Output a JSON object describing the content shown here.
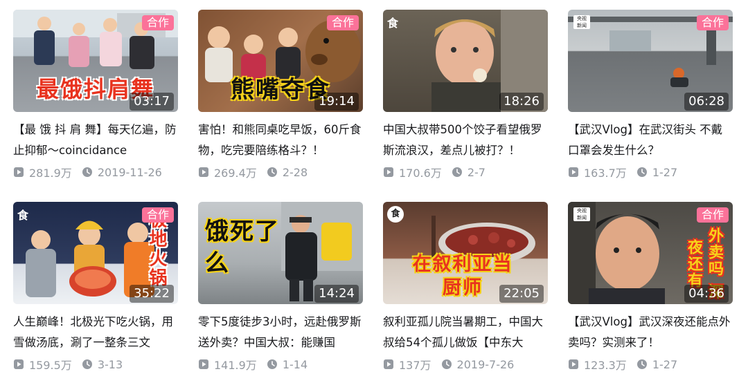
{
  "videos": [
    {
      "title": "【最 饿 抖 肩 舞】每天亿遍，防止抑郁～coincidance",
      "caption": "最饿抖肩舞",
      "coop": "合作",
      "duration": "03:17",
      "views": "281.9万",
      "date": "2019-11-26"
    },
    {
      "title": "害怕！和熊同桌吃早饭，60斤食物，吃完要陪练格斗？！",
      "caption": "熊嘴夺食",
      "coop": "合作",
      "duration": "19:14",
      "views": "269.4万",
      "date": "2-28"
    },
    {
      "title": "中国大叔带500个饺子看望俄罗斯流浪汉，差点儿被打？！",
      "caption": "",
      "coop": "",
      "duration": "18:26",
      "views": "170.6万",
      "date": "2-7"
    },
    {
      "title": "【武汉Vlog】在武汉街头 不戴口罩会发生什么？",
      "caption": "",
      "coop": "合作",
      "duration": "06:28",
      "views": "163.7万",
      "date": "1-27"
    },
    {
      "title": "人生巅峰！北极光下吃火锅，用雪做汤底，涮了一整条三文",
      "caption": "极地火锅",
      "coop": "合作",
      "duration": "35:22",
      "views": "159.5万",
      "date": "3-13"
    },
    {
      "title": "零下5度徒步3小时，远赴俄罗斯送外卖？中国大叔：能赚国",
      "caption": "饿死了么",
      "coop": "",
      "duration": "14:24",
      "views": "141.9万",
      "date": "1-14"
    },
    {
      "title": "叙利亚孤儿院当暑期工，中国大叔给54个孤儿做饭【中东大",
      "caption": "在叙利亚当厨师",
      "coop": "",
      "duration": "22:05",
      "views": "137万",
      "date": "2019-7-26"
    },
    {
      "title": "【武汉Vlog】武汉深夜还能点外卖吗？实测来了！",
      "caption": "外卖吗 深夜还有",
      "coop": "合作",
      "duration": "04:36",
      "views": "123.3万",
      "date": "1-27"
    }
  ],
  "colors": {
    "coop_badge": "#fb7299",
    "meta_text": "#9499a0",
    "title_text": "#18191c",
    "caption_red": "#e8331f"
  },
  "icons": {
    "views": "play-icon",
    "date": "clock-icon"
  }
}
